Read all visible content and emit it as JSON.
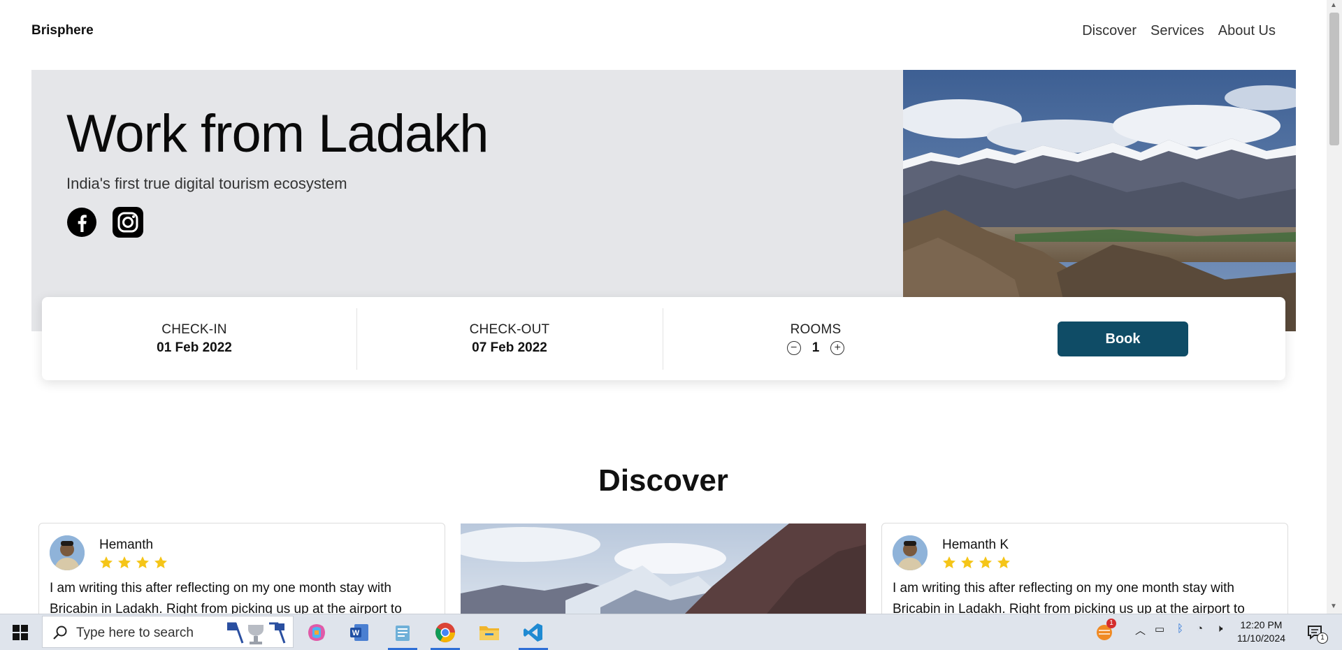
{
  "header": {
    "brand": "Brisphere",
    "nav": [
      "Discover",
      "Services",
      "About Us"
    ]
  },
  "hero": {
    "title": "Work from Ladakh",
    "subtitle": "India's first true digital tourism ecosystem",
    "social_icons": [
      "facebook-icon",
      "instagram-icon"
    ]
  },
  "booking": {
    "checkin_label": "CHECK-IN",
    "checkin_value": "01 Feb 2022",
    "checkout_label": "CHECK-OUT",
    "checkout_value": "07 Feb 2022",
    "rooms_label": "ROOMS",
    "rooms_value": "1",
    "book_label": "Book"
  },
  "discover": {
    "heading": "Discover",
    "reviews": [
      {
        "name": "Hemanth",
        "rating": 4,
        "text": "I am writing this after reflecting on my one month stay with Bricabin in Ladakh. Right from picking us up at the airport to"
      },
      {
        "name": "Hemanth K",
        "rating": 4,
        "text": "I am writing this after reflecting on my one month stay with Bricabin in Ladakh. Right from picking us up at the airport to"
      }
    ]
  },
  "taskbar": {
    "search_placeholder": "Type here to search",
    "apps": [
      "copilot-icon",
      "word-icon",
      "notepad-icon",
      "chrome-icon",
      "file-explorer-icon",
      "vscode-icon"
    ],
    "time": "12:20 PM",
    "date": "11/10/2024",
    "notification_count": "1",
    "weather_badge": "1"
  },
  "colors": {
    "hero_bg": "#e5e6e9",
    "book_button": "#0f4c66",
    "star": "#f5c518",
    "taskbar_bg": "#dfe4ec"
  }
}
